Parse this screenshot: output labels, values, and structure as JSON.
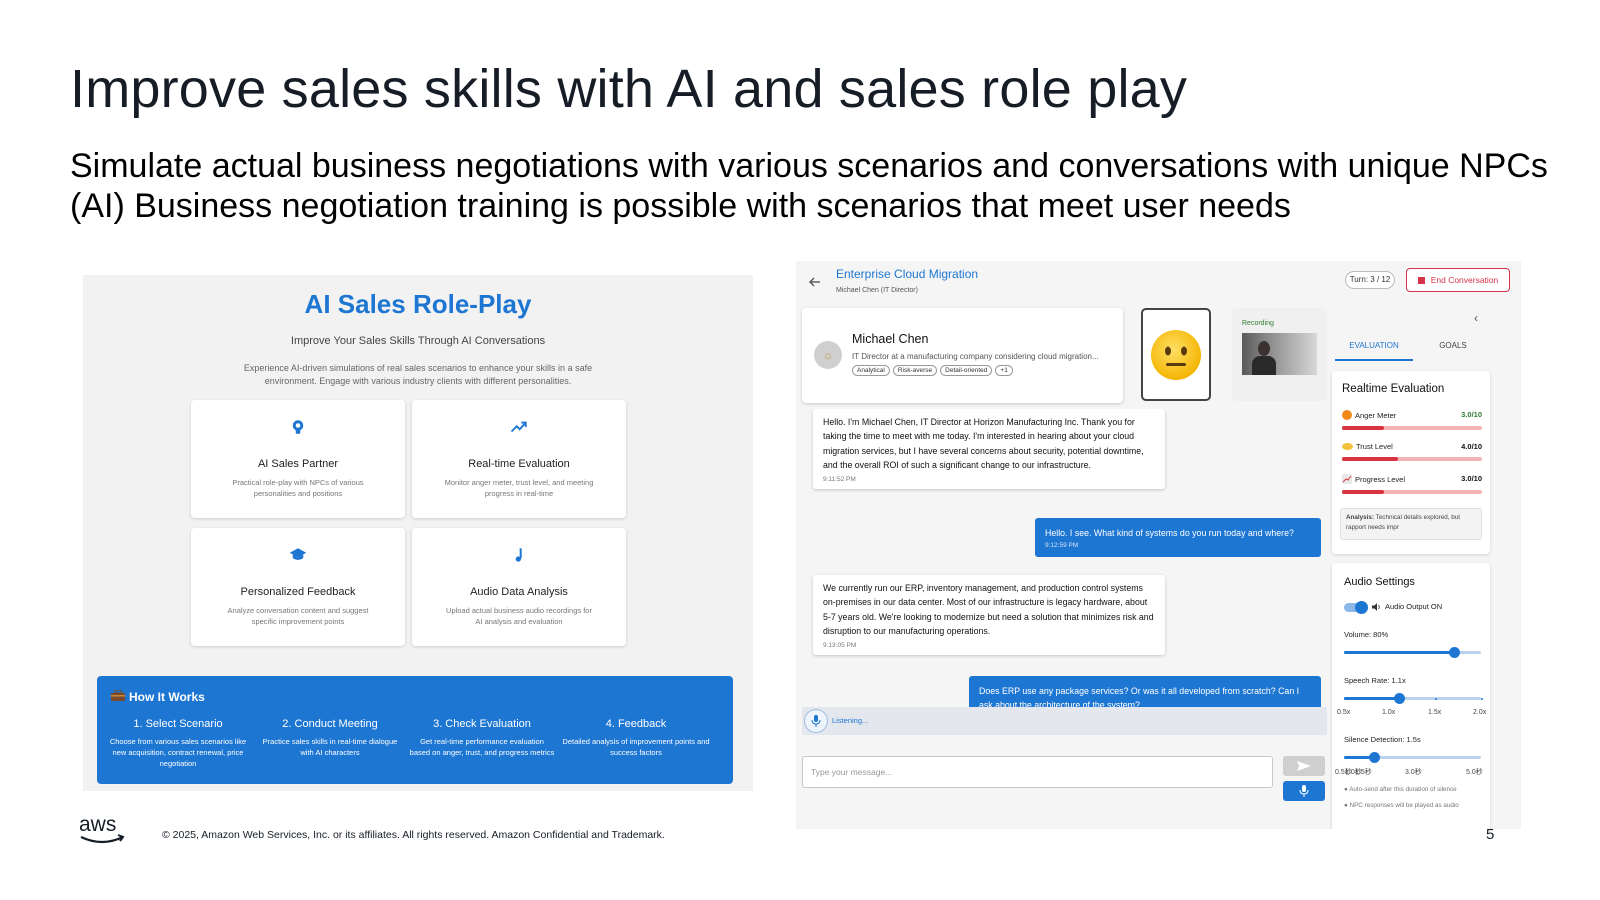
{
  "slide": {
    "title": "Improve sales skills with AI and sales role play",
    "subtitle": "Simulate actual business negotiations with various scenarios and conversations with unique NPCs (AI) Business negotiation training is possible with scenarios that meet user needs",
    "copyright": "© 2025, Amazon Web Services, Inc. or its affiliates. All rights reserved. Amazon Confidential and Trademark.",
    "page_number": "5",
    "logo_text": "aws"
  },
  "landing": {
    "title": "AI Sales Role-Play",
    "subtitle": "Improve Your Sales Skills Through AI Conversations",
    "description": "Experience AI-driven simulations of real sales scenarios to enhance your skills in a safe environment. Engage with various industry clients with different personalities.",
    "features": [
      {
        "icon": "brain-icon",
        "title": "AI Sales Partner",
        "description": "Practical role-play with NPCs of various personalities and positions"
      },
      {
        "icon": "trending-up-icon",
        "title": "Real-time Evaluation",
        "description": "Monitor anger meter, trust level, and meeting progress in real-time"
      },
      {
        "icon": "graduation-cap-icon",
        "title": "Personalized Feedback",
        "description": "Analyze conversation content and suggest specific improvement points"
      },
      {
        "icon": "music-note-icon",
        "title": "Audio Data Analysis",
        "description": "Upload actual business audio recordings for AI analysis and evaluation"
      }
    ],
    "how_it_works": {
      "icon": "toolbox-icon",
      "title": "How It Works",
      "steps": [
        {
          "title": "1. Select Scenario",
          "description": "Choose from various sales scenarios like new acquisition, contract renewal, price negotiation"
        },
        {
          "title": "2. Conduct Meeting",
          "description": "Practice sales skills in real-time dialogue with AI characters"
        },
        {
          "title": "3. Check Evaluation",
          "description": "Get real-time performance evaluation based on anger, trust, and progress metrics"
        },
        {
          "title": "4. Feedback",
          "description": "Detailed analysis of improvement points and success factors"
        }
      ]
    }
  },
  "session": {
    "scenario_title": "Enterprise Cloud Migration",
    "scenario_subtitle": "Michael Chen (IT Director)",
    "turn": "Turn: 3 / 12",
    "end_button": "End Conversation",
    "npc": {
      "name": "Michael Chen",
      "role": "IT Director at a manufacturing company considering cloud migration...",
      "tags": [
        "Analytical",
        "Risk-averse",
        "Detail-oriented",
        "+1"
      ],
      "emotion_icon": "neutral-face-icon"
    },
    "recording_label": "Recording",
    "messages": [
      {
        "sender": "npc",
        "text": "Hello. I'm Michael Chen, IT Director at Horizon Manufacturing Inc. Thank you for taking the time to meet with me today. I'm interested in hearing about your cloud migration services, but I have several concerns about security, potential downtime, and the overall ROI of such a significant change to our infrastructure.",
        "time": "9:11:52 PM"
      },
      {
        "sender": "user",
        "text": "Hello. I see. What kind of systems do you run today and where?",
        "time": "9:12:59 PM"
      },
      {
        "sender": "npc",
        "text": "We currently run our ERP, inventory management, and production control systems on-premises in our data center. Most of our infrastructure is legacy hardware, about 5-7 years old. We're looking to modernize but need a solution that minimizes risk and disruption to our manufacturing operations.",
        "time": "9:13:05 PM"
      },
      {
        "sender": "user",
        "text": "Does ERP use any package services? Or was it all developed from scratch? Can I ask about the architecture of the system?",
        "time": ""
      }
    ],
    "listening_text": "Listening...",
    "input_placeholder": "Type your message...",
    "tabs": [
      "EVALUATION",
      "GOALS"
    ],
    "evaluation": {
      "title": "Realtime Evaluation",
      "meters": [
        {
          "icon": "anger-face-icon",
          "label": "Anger Meter",
          "value": "3.0/10",
          "fraction": 0.3,
          "value_color": "#2e7d32"
        },
        {
          "icon": "handshake-icon",
          "label": "Trust Level",
          "value": "4.0/10",
          "fraction": 0.4,
          "value_color": "#111111"
        },
        {
          "icon": "chart-icon",
          "label": "Progress Level",
          "value": "3.0/10",
          "fraction": 0.3,
          "value_color": "#111111"
        }
      ],
      "analysis_label": "Analysis:",
      "analysis_text": "Technical details explored, but rapport needs impr"
    },
    "audio": {
      "title": "Audio Settings",
      "output_label": "Audio Output ON",
      "output_on": true,
      "volume_label": "Volume: 80%",
      "volume_fraction": 0.8,
      "speech_label": "Speech Rate: 1.1x",
      "speech_fraction": 0.4,
      "speech_marks": [
        "0.5x",
        "1.0x",
        "1.5x",
        "2.0x"
      ],
      "silence_label": "Silence Detection: 1.5s",
      "silence_fraction": 0.22,
      "silence_marks": [
        "0.5秒",
        "1.0秒",
        "1.5秒",
        "3.0秒",
        "5.0秒"
      ],
      "notes": [
        "Auto-send after this duration of silence",
        "NPC responses will be played as audio"
      ]
    }
  }
}
